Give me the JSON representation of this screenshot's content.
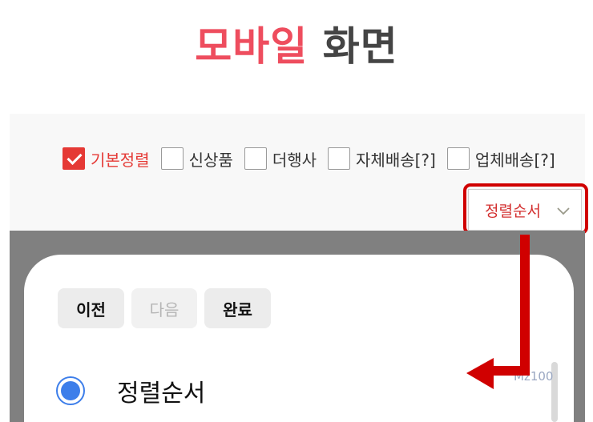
{
  "header": {
    "title_red": "모바일",
    "title_dark": "화면"
  },
  "filters": [
    {
      "label": "기본정렬",
      "checked": true
    },
    {
      "label": "신상품",
      "checked": false
    },
    {
      "label": "더행사",
      "checked": false
    },
    {
      "label": "자체배송[?]",
      "checked": false
    },
    {
      "label": "업체배송[?]",
      "checked": false
    }
  ],
  "sort_dropdown": {
    "selected": "정렬순서"
  },
  "sheet": {
    "prev_label": "이전",
    "next_label": "다음",
    "done_label": "완료",
    "option_label": "정렬순서",
    "option_selected": true
  },
  "watermark": "Mz100",
  "colors": {
    "accent_red": "#e53935",
    "title_red": "#ee4d5e",
    "radio_blue": "#3d7eea",
    "annotation_red": "#d00000"
  }
}
